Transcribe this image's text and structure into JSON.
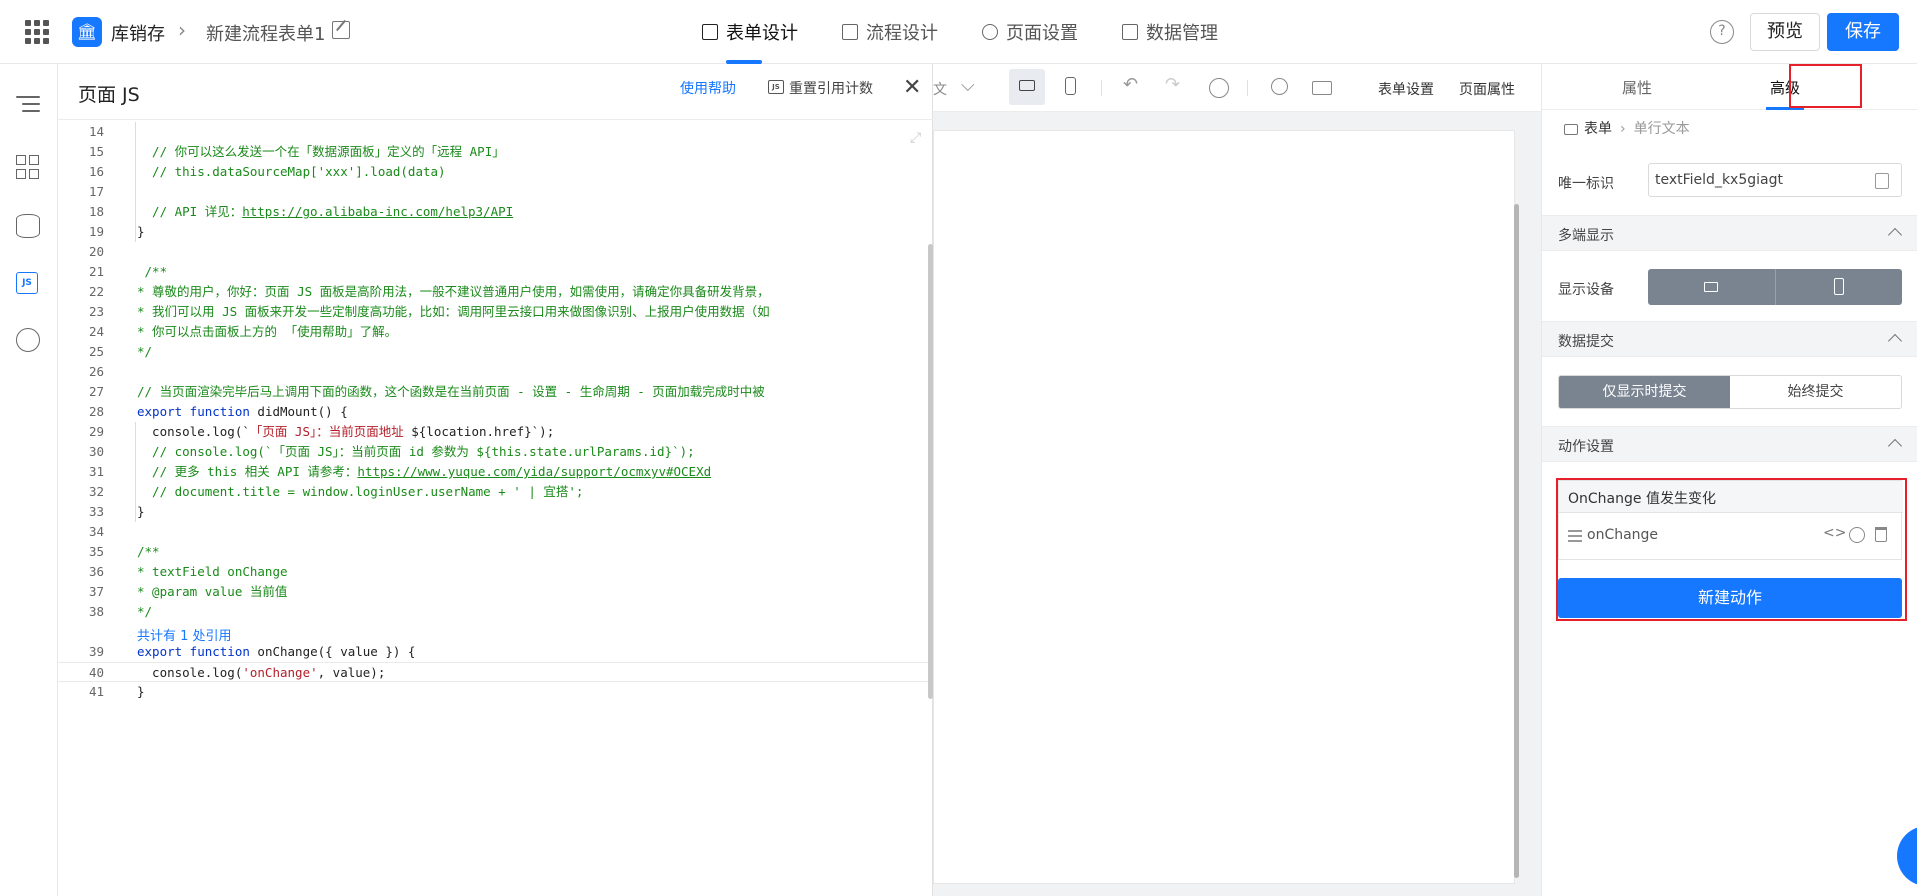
{
  "header": {
    "app_icon": "bank-icon",
    "app_name": "库销存",
    "form_name": "新建流程表单1",
    "tabs": [
      {
        "label": "表单设计",
        "icon": "document-icon",
        "active": true
      },
      {
        "label": "流程设计",
        "icon": "flow-icon",
        "active": false
      },
      {
        "label": "页面设置",
        "icon": "gear-icon",
        "active": false
      },
      {
        "label": "数据管理",
        "icon": "table-icon",
        "active": false
      }
    ],
    "help": "?",
    "preview_label": "预览",
    "save_label": "保存",
    "accent_color": "#1677ff"
  },
  "js_panel": {
    "title": "页面 JS",
    "help_link": "使用帮助",
    "reset_icon_text": "JS",
    "reset_label": "重置引用计数",
    "close": "✕",
    "resize": "⤢",
    "ref_count": "共计有 1 处引用",
    "lines": [
      {
        "n": "14",
        "parts": [
          {
            "t": "",
            "c": "c-plain"
          }
        ]
      },
      {
        "n": "15",
        "parts": [
          {
            "t": "  // 你可以这么发送一个在「数据源面板」定义的「远程 API」",
            "c": "c-com"
          }
        ]
      },
      {
        "n": "16",
        "parts": [
          {
            "t": "  // this.dataSourceMap['xxx'].load(data)",
            "c": "c-com"
          }
        ]
      },
      {
        "n": "17",
        "parts": [
          {
            "t": "",
            "c": "c-plain"
          }
        ]
      },
      {
        "n": "18",
        "parts": [
          {
            "t": "  // API 详见：",
            "c": "c-com"
          },
          {
            "t": "https://go.alibaba-inc.com/help3/API",
            "c": "c-link"
          }
        ]
      },
      {
        "n": "19",
        "parts": [
          {
            "t": "}",
            "c": "c-plain"
          }
        ]
      },
      {
        "n": "20",
        "parts": [
          {
            "t": "",
            "c": "c-plain"
          }
        ]
      },
      {
        "n": "21",
        "parts": [
          {
            "t": " /**",
            "c": "c-com"
          }
        ]
      },
      {
        "n": "22",
        "parts": [
          {
            "t": "* 尊敬的用户，你好：页面 JS 面板是高阶用法，一般不建议普通用户使用，如需使用，请确定你具备研发背景，",
            "c": "c-com"
          }
        ]
      },
      {
        "n": "23",
        "parts": [
          {
            "t": "* 我们可以用 JS 面板来开发一些定制度高功能，比如：调用阿里云接口用来做图像识别、上报用户使用数据（如",
            "c": "c-com"
          }
        ]
      },
      {
        "n": "24",
        "parts": [
          {
            "t": "* 你可以点击面板上方的 「使用帮助」了解。",
            "c": "c-com"
          }
        ]
      },
      {
        "n": "25",
        "parts": [
          {
            "t": "*/",
            "c": "c-com"
          }
        ]
      },
      {
        "n": "26",
        "parts": [
          {
            "t": "",
            "c": "c-plain"
          }
        ]
      },
      {
        "n": "27",
        "parts": [
          {
            "t": "// 当页面渲染完毕后马上调用下面的函数，这个函数是在当前页面 - 设置 - 生命周期 - 页面加载完成时中被",
            "c": "c-com"
          }
        ]
      },
      {
        "n": "28",
        "parts": [
          {
            "t": "export function ",
            "c": "c-kw"
          },
          {
            "t": "didMount() {",
            "c": "c-plain"
          }
        ]
      },
      {
        "n": "29",
        "parts": [
          {
            "t": "  console.log(`",
            "c": "c-plain"
          },
          {
            "t": "「页面 JS」：当前页面地址",
            "c": "c-str"
          },
          {
            "t": " ${location.href}`);",
            "c": "c-plain"
          }
        ]
      },
      {
        "n": "30",
        "parts": [
          {
            "t": "  // console.log(`「页面 JS」：当前页面 id 参数为 ${this.state.urlParams.id}`);",
            "c": "c-com"
          }
        ]
      },
      {
        "n": "31",
        "parts": [
          {
            "t": "  // 更多 this 相关 API 请参考：",
            "c": "c-com"
          },
          {
            "t": "https://www.yuque.com/yida/support/ocmxyv#OCEXd",
            "c": "c-link"
          }
        ]
      },
      {
        "n": "32",
        "parts": [
          {
            "t": "  // document.title = window.loginUser.userName + ' | 宜搭';",
            "c": "c-com"
          }
        ]
      },
      {
        "n": "33",
        "parts": [
          {
            "t": "}",
            "c": "c-plain"
          }
        ]
      },
      {
        "n": "34",
        "parts": [
          {
            "t": "",
            "c": "c-plain"
          }
        ]
      },
      {
        "n": "35",
        "parts": [
          {
            "t": "/**",
            "c": "c-com"
          }
        ]
      },
      {
        "n": "36",
        "parts": [
          {
            "t": "* textField onChange",
            "c": "c-com"
          }
        ]
      },
      {
        "n": "37",
        "parts": [
          {
            "t": "* @param value 当前值",
            "c": "c-com"
          }
        ]
      },
      {
        "n": "38",
        "parts": [
          {
            "t": "*/",
            "c": "c-com"
          }
        ]
      },
      {
        "n": "39",
        "parts": [
          {
            "t": "export function ",
            "c": "c-kw"
          },
          {
            "t": "onChange({ value }) {",
            "c": "c-plain"
          }
        ]
      },
      {
        "n": "40",
        "parts": [
          {
            "t": "  console.log(",
            "c": "c-plain"
          },
          {
            "t": "'onChange'",
            "c": "c-str"
          },
          {
            "t": ", value);",
            "c": "c-plain"
          }
        ]
      },
      {
        "n": "41",
        "parts": [
          {
            "t": "}",
            "c": "c-plain"
          }
        ]
      }
    ]
  },
  "left_sidebar": {
    "items": [
      {
        "icon": "outline-icon"
      },
      {
        "icon": "components-icon"
      },
      {
        "icon": "datasource-icon"
      },
      {
        "icon": "js-icon",
        "label": "JS",
        "active": true
      },
      {
        "icon": "globe-icon"
      }
    ]
  },
  "canvas_toolbar": {
    "truncated_text": "文",
    "form_settings": "表单设置",
    "page_props": "页面属性"
  },
  "right_panel": {
    "tabs": [
      {
        "label": "属性",
        "active": false
      },
      {
        "label": "高级",
        "active": true
      }
    ],
    "breadcrumb": {
      "root": "表单",
      "current": "单行文本"
    },
    "unique_id_label": "唯一标识",
    "unique_id_value": "textField_kx5giagt",
    "sections": {
      "multi_display": "多端显示",
      "data_submit": "数据提交",
      "action_settings": "动作设置"
    },
    "display_device_label": "显示设备",
    "submit_options": [
      {
        "label": "仅显示时提交",
        "active": true
      },
      {
        "label": "始终提交",
        "active": false
      }
    ],
    "action_card": {
      "title": "OnChange 值发生变化",
      "action_name": "onChange",
      "code_icon_text": "<>"
    },
    "new_action_label": "新建动作",
    "highlight_color": "#e5202a"
  }
}
